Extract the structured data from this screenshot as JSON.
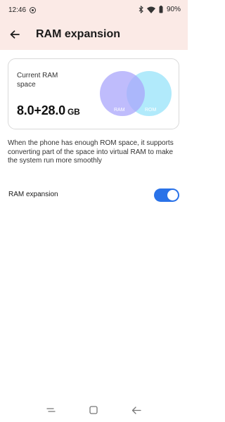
{
  "status_bar": {
    "time": "12:46",
    "battery": "90%",
    "icons": [
      "record-icon",
      "bluetooth-icon",
      "wifi-icon",
      "battery-icon"
    ]
  },
  "app_bar": {
    "title": "RAM expansion",
    "back_icon": "back-arrow-icon"
  },
  "ram_card": {
    "label": "Current RAM space",
    "value": "8.0+28.0",
    "unit": "GB",
    "venn_ram_label": "RAM",
    "venn_rom_label": "ROM",
    "ram_color": "#a9a5fb",
    "rom_color": "#a8e8fb"
  },
  "description": "When the phone has enough ROM space, it supports converting part of the space into virtual RAM to make the system run more smoothly",
  "setting": {
    "label": "RAM expansion",
    "enabled": true,
    "accent": "#2a72e8"
  },
  "nav_bar": {
    "icons": [
      "recents-icon",
      "home-icon",
      "back-icon"
    ]
  },
  "colors": {
    "header_background": "#fbeae6"
  }
}
